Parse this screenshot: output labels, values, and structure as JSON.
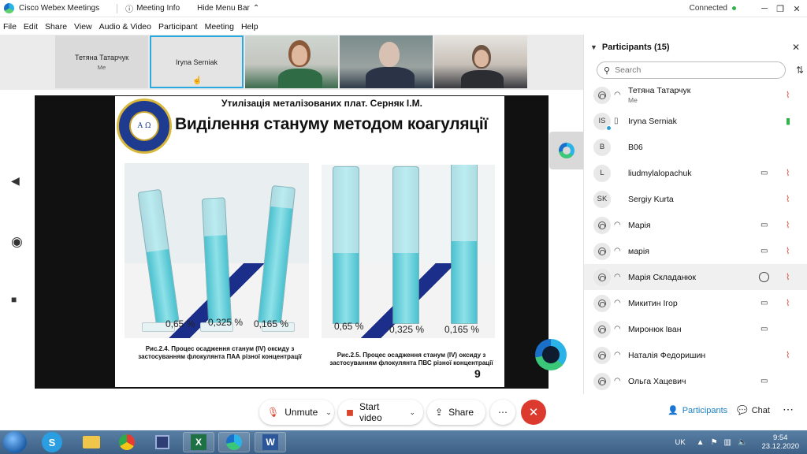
{
  "titlebar": {
    "app_name": "Cisco Webex Meetings",
    "meeting_info": "Meeting Info",
    "hide_menu": "Hide Menu Bar",
    "status": "Connected",
    "status_color": "#2fb34a"
  },
  "menu": [
    "File",
    "Edit",
    "Share",
    "View",
    "Audio & Video",
    "Participant",
    "Meeting",
    "Help"
  ],
  "strip": {
    "tile1_name": "Тетяна Татарчук",
    "tile1_sub": "Me",
    "tile2_name": "Iryna Serniak"
  },
  "slide": {
    "subtitle": "Утилізація металізованих плат. Серняк І.М.",
    "title": "Виділення стануму методом коагуляції",
    "logo_text": "A Ω",
    "photo1_labels": [
      "0,65 %",
      "0,325 %",
      "0,165 %"
    ],
    "photo2_labels": [
      "0,65 %",
      "0,325 %",
      "0,165 %"
    ],
    "caption1_line1": "Рис.2.4. Процес осадження станум (IV) оксиду з",
    "caption1_line2": "застосуванням  флокулянта ПАА різної концентрації",
    "caption2_line1": "Рис.2.5. Процес осадження станум (IV) оксиду з",
    "caption2_line2": "застосуванням  флокулянта ПВС різної концентрації",
    "page_number": "9",
    "liquid_levels_photo1": [
      0.55,
      0.7,
      0.85
    ],
    "liquid_levels_photo2": [
      0.45,
      0.45,
      0.5
    ]
  },
  "participants": {
    "title": "Participants (15)",
    "search_placeholder": "Search",
    "list": [
      {
        "name": "Тетяна Татарчук",
        "sub": "Me",
        "avatar": "person-icon",
        "device": "headset-icon",
        "video": false,
        "chat": false,
        "mic": "muted"
      },
      {
        "name": "Iryna Serniak",
        "sub": "",
        "avatar": "IS",
        "device": "phone-icon",
        "video": false,
        "chat": false,
        "mic": "live"
      },
      {
        "name": "B06",
        "sub": "",
        "avatar": "B",
        "device": "",
        "video": false,
        "chat": false,
        "mic": "none"
      },
      {
        "name": "liudmylalopachuk",
        "sub": "",
        "avatar": "L",
        "device": "",
        "video": true,
        "chat": false,
        "mic": "muted"
      },
      {
        "name": "Sergiy Kurta",
        "sub": "",
        "avatar": "SK",
        "device": "",
        "video": false,
        "chat": false,
        "mic": "muted"
      },
      {
        "name": "Марія",
        "sub": "",
        "avatar": "person-icon",
        "device": "headset-icon",
        "video": true,
        "chat": false,
        "mic": "muted"
      },
      {
        "name": "марія",
        "sub": "",
        "avatar": "person-icon",
        "device": "headset-icon",
        "video": true,
        "chat": false,
        "mic": "muted"
      },
      {
        "name": "Марія Складанюк",
        "sub": "",
        "avatar": "person-icon",
        "device": "headset-icon",
        "video": false,
        "chat": true,
        "mic": "muted"
      },
      {
        "name": "Микитин Ігор",
        "sub": "",
        "avatar": "person-icon",
        "device": "headset-icon",
        "video": true,
        "chat": false,
        "mic": "muted"
      },
      {
        "name": "Миронюк Іван",
        "sub": "",
        "avatar": "person-icon",
        "device": "headset-icon",
        "video": true,
        "chat": false,
        "mic": "none"
      },
      {
        "name": "Наталія Федоришин",
        "sub": "",
        "avatar": "person-icon",
        "device": "headset-icon",
        "video": false,
        "chat": false,
        "mic": "muted"
      },
      {
        "name": "Ольга Хацевич",
        "sub": "",
        "avatar": "person-icon",
        "device": "headset-icon",
        "video": true,
        "chat": false,
        "mic": "none"
      }
    ]
  },
  "controls": {
    "unmute": "Unmute",
    "start_video": "Start video",
    "share": "Share",
    "participants_tab": "Participants",
    "chat_tab": "Chat",
    "end_color": "#dc3a2f",
    "accent": "#1b7fc3"
  },
  "taskbar": {
    "apps": [
      "windows-start-icon",
      "skype-icon",
      "file-explorer-icon",
      "chrome-icon",
      "save-disk-icon",
      "excel-icon",
      "webex-icon",
      "word-icon"
    ],
    "language": "UK",
    "time": "9:54",
    "date": "23.12.2020"
  }
}
